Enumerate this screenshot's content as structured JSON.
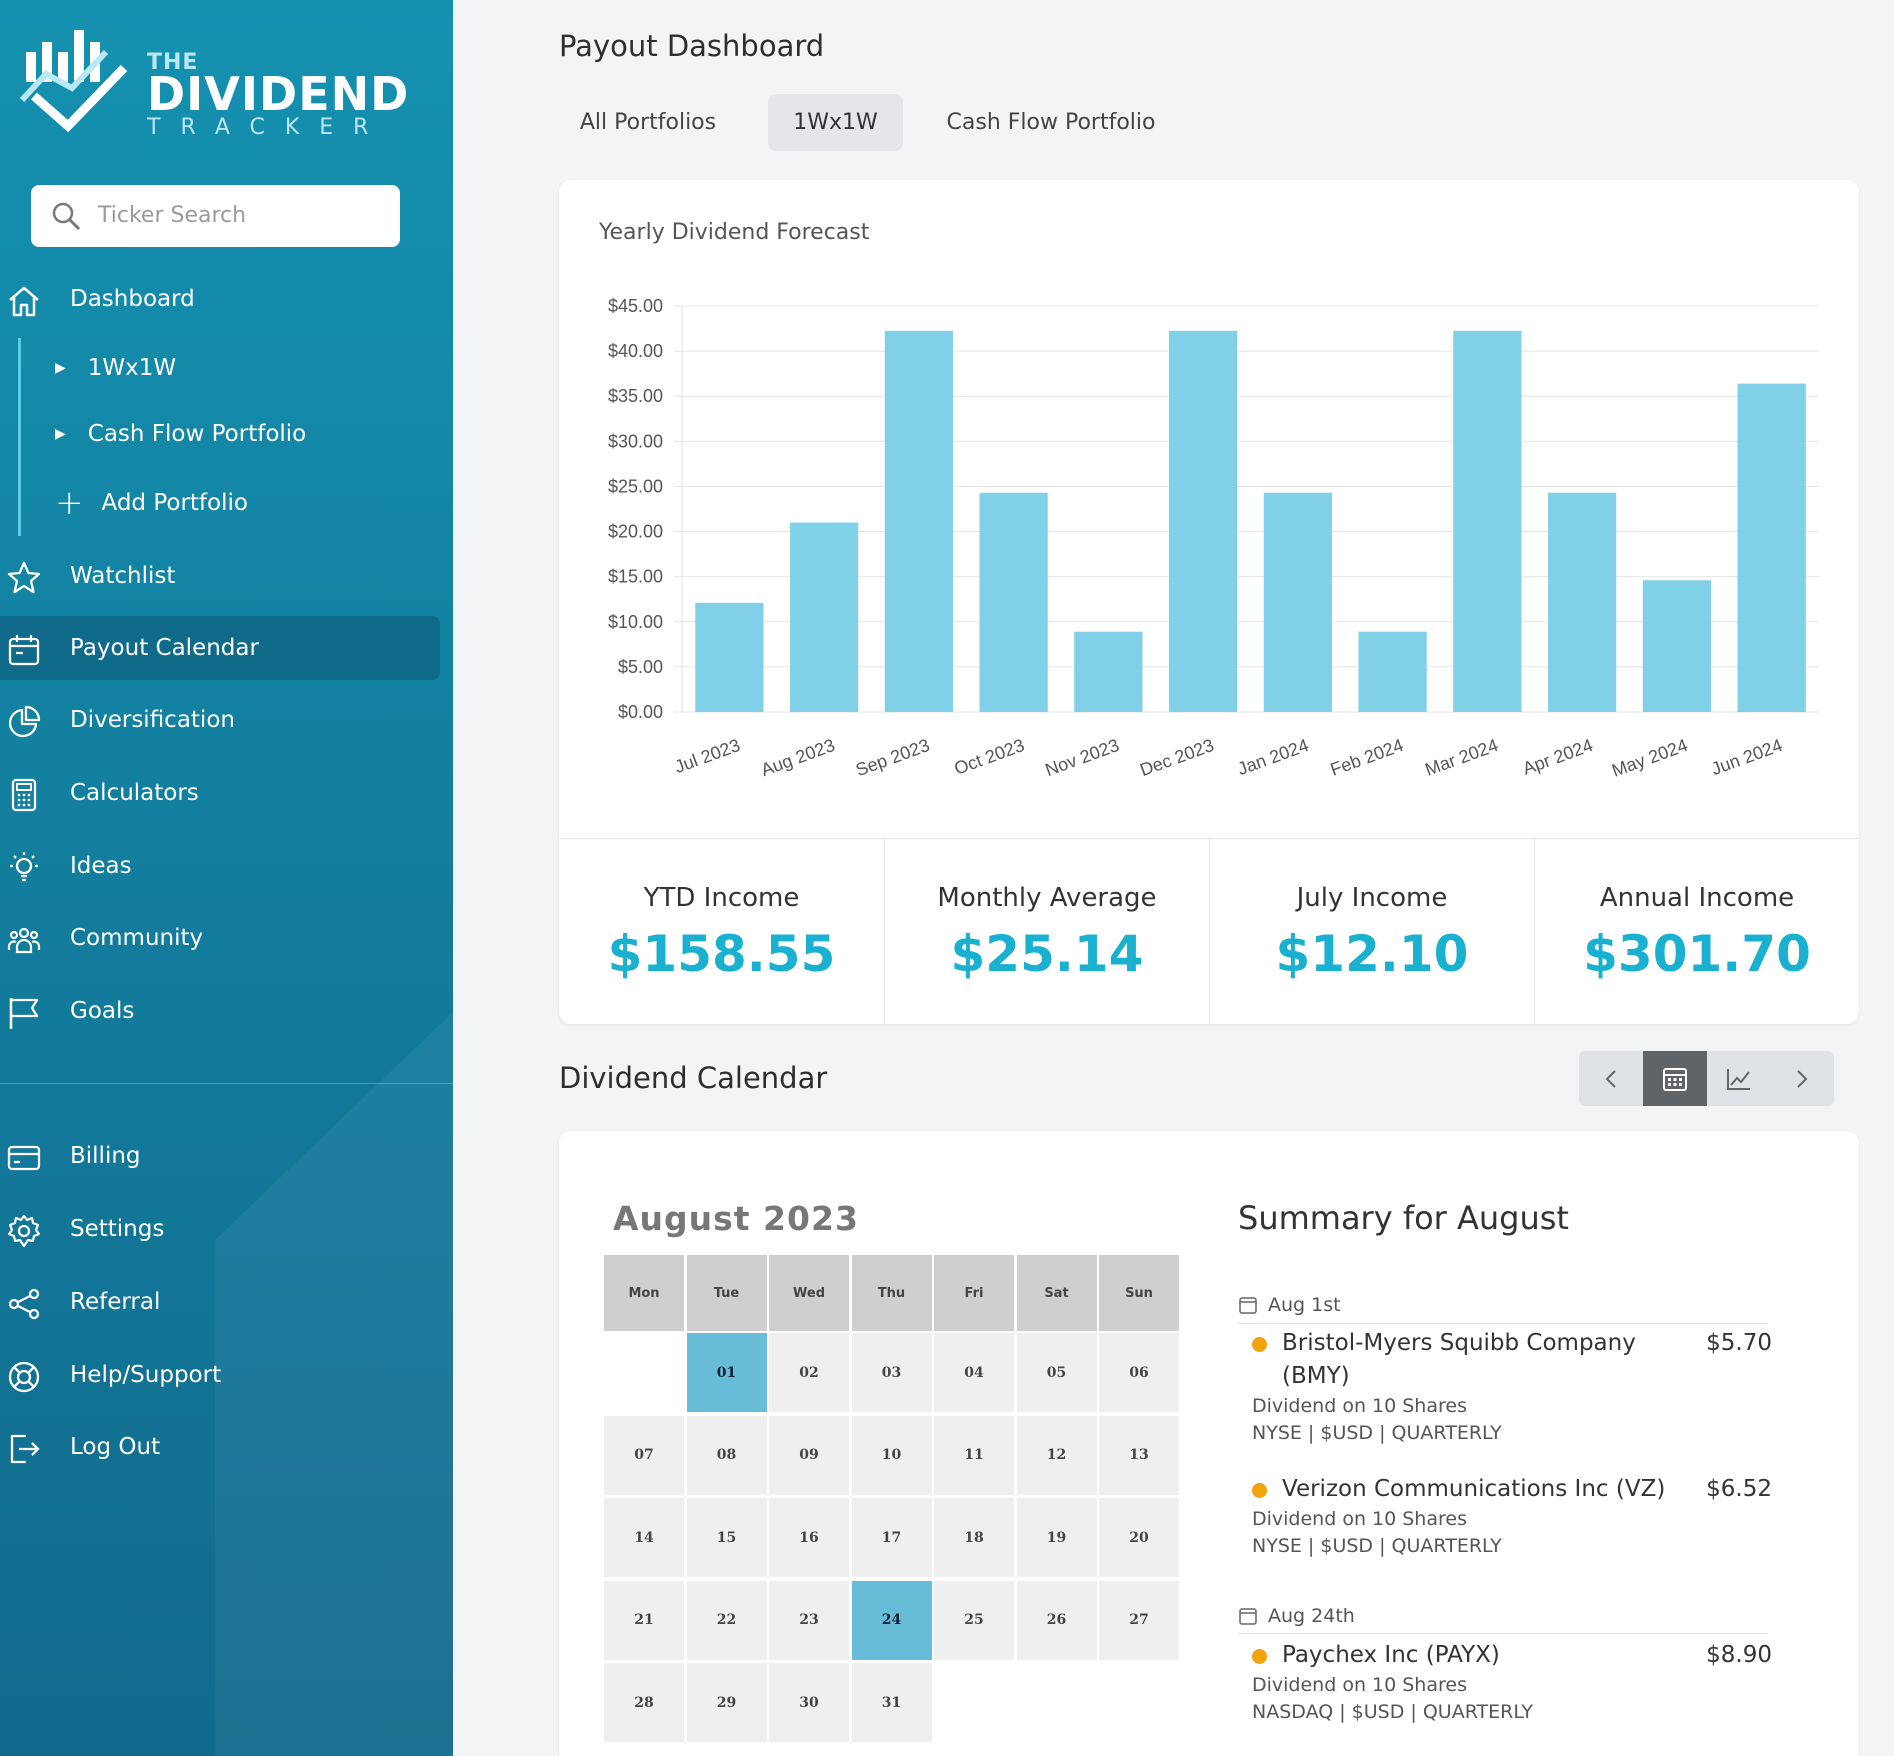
{
  "brand": {
    "the": "THE",
    "name": "DIVIDEND",
    "tracker": "TRACKER"
  },
  "search": {
    "placeholder": "Ticker Search"
  },
  "nav": {
    "dashboard": "Dashboard",
    "portfolios": [
      {
        "label": "1Wx1W",
        "icon": "triangle-right-icon"
      },
      {
        "label": "Cash Flow Portfolio",
        "icon": "triangle-right-icon"
      },
      {
        "label": "Add Portfolio",
        "icon": "plus-icon"
      }
    ],
    "watchlist": "Watchlist",
    "payout_calendar": "Payout Calendar",
    "diversification": "Diversification",
    "calculators": "Calculators",
    "ideas": "Ideas",
    "community": "Community",
    "goals": "Goals",
    "billing": "Billing",
    "settings": "Settings",
    "referral": "Referral",
    "help": "Help/Support",
    "logout": "Log Out",
    "active": "Payout Calendar"
  },
  "header": {
    "title": "Payout Dashboard"
  },
  "tabs": [
    {
      "label": "All Portfolios",
      "active": false
    },
    {
      "label": "1Wx1W",
      "active": true
    },
    {
      "label": "Cash Flow Portfolio",
      "active": false
    }
  ],
  "chart_card": {
    "title": "Yearly Dividend Forecast"
  },
  "chart_data": {
    "type": "bar",
    "title": "Yearly Dividend Forecast",
    "categories": [
      "Jul 2023",
      "Aug 2023",
      "Sep 2023",
      "Oct 2023",
      "Nov 2023",
      "Dec 2023",
      "Jan 2024",
      "Feb 2024",
      "Mar 2024",
      "Apr 2024",
      "May 2024",
      "Jun 2024"
    ],
    "values": [
      12.1,
      21.0,
      42.25,
      24.3,
      8.9,
      42.25,
      24.3,
      8.9,
      42.25,
      24.3,
      14.6,
      36.4
    ],
    "ylim": [
      0,
      45
    ],
    "yticks": [
      "$0.00",
      "$5.00",
      "$10.00",
      "$15.00",
      "$20.00",
      "$25.00",
      "$30.00",
      "$35.00",
      "$40.00",
      "$45.00"
    ],
    "grid": true,
    "color": "#80d1e8"
  },
  "stats": [
    {
      "label": "YTD Income",
      "value": "$158.55"
    },
    {
      "label": "Monthly Average",
      "value": "$25.14"
    },
    {
      "label": "July Income",
      "value": "$12.10"
    },
    {
      "label": "Annual Income",
      "value": "$301.70"
    }
  ],
  "calendar_section": {
    "title": "Dividend Calendar"
  },
  "calendar": {
    "month_label": "August 2023",
    "weekdays": [
      "Mon",
      "Tue",
      "Wed",
      "Thu",
      "Fri",
      "Sat",
      "Sun"
    ],
    "days": [
      "01",
      "02",
      "03",
      "04",
      "05",
      "06",
      "07",
      "08",
      "09",
      "10",
      "11",
      "12",
      "13",
      "14",
      "15",
      "16",
      "17",
      "18",
      "19",
      "20",
      "21",
      "22",
      "23",
      "24",
      "25",
      "26",
      "27",
      "28",
      "29",
      "30",
      "31"
    ],
    "highlighted": [
      "01",
      "24"
    ]
  },
  "summary": {
    "title": "Summary for August",
    "groups": [
      {
        "date": "Aug 1st",
        "entries": [
          {
            "name": "Bristol-Myers Squibb Company (BMY)",
            "amount": "$5.70",
            "detail": "Dividend on 10 Shares",
            "meta": "NYSE | $USD | QUARTERLY"
          },
          {
            "name": "Verizon Communications Inc (VZ)",
            "amount": "$6.52",
            "detail": "Dividend on 10 Shares",
            "meta": "NYSE | $USD | QUARTERLY"
          }
        ]
      },
      {
        "date": "Aug 24th",
        "entries": [
          {
            "name": "Paychex Inc (PAYX)",
            "amount": "$8.90",
            "detail": "Dividend on 10 Shares",
            "meta": "NASDAQ | $USD | QUARTERLY"
          }
        ]
      }
    ]
  },
  "colors": {
    "accent": "#1ab0cf",
    "sidebar": "#1591b0",
    "bar": "#80d1e8",
    "dot": "#f2a20b",
    "highlight": "#67bcd8"
  }
}
